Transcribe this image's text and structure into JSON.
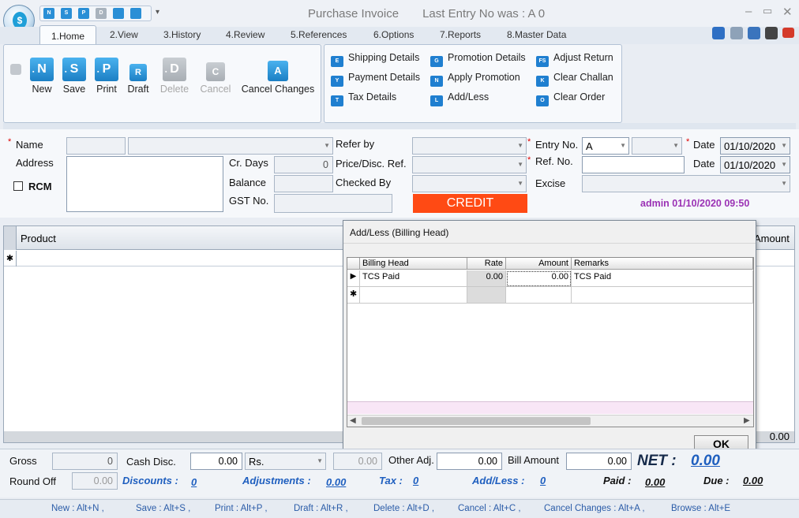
{
  "window": {
    "title": "Purchase Invoice",
    "last_entry": "Last Entry No was : A 0",
    "logo": "$"
  },
  "qat": {
    "icons": [
      "new-icon",
      "save-icon",
      "print-icon",
      "draft-icon",
      "doc-icon",
      "doc2-icon"
    ],
    "labels": [
      "N",
      "S",
      "P",
      "D",
      "",
      ""
    ],
    "more": "▾"
  },
  "tabs": [
    "1.Home",
    "2.View",
    "3.History",
    "4.Review",
    "5.References",
    "6.Options",
    "7.Reports",
    "8.Master Data"
  ],
  "ribbon": {
    "buttons": [
      {
        "label": "New",
        "key": "N"
      },
      {
        "label": "Save",
        "key": "S"
      },
      {
        "label": "Print",
        "key": "P"
      },
      {
        "label": "Draft",
        "key": "R"
      },
      {
        "label": "Delete",
        "key": "D"
      },
      {
        "label": "Cancel",
        "key": "C"
      },
      {
        "label": "Cancel Changes",
        "key": "A"
      }
    ],
    "links": [
      {
        "label": "Shipping Details",
        "key": "E"
      },
      {
        "label": "Payment Details",
        "key": "Y"
      },
      {
        "label": "Tax Details",
        "key": "T"
      },
      {
        "label": "Promotion Details",
        "key": "G"
      },
      {
        "label": "Apply Promotion",
        "key": "N"
      },
      {
        "label": "Add/Less",
        "key": "L"
      },
      {
        "label": "Adjust Return",
        "key": "FS"
      },
      {
        "label": "Clear Challan",
        "key": "K"
      },
      {
        "label": "Clear Order",
        "key": "O"
      }
    ]
  },
  "form": {
    "name_label": "Name",
    "address_label": "Address",
    "rcm_label": "RCM",
    "cr_days_label": "Cr. Days",
    "cr_days_value": "0",
    "balance_label": "Balance",
    "gst_label": "GST No.",
    "refer_by_label": "Refer by",
    "price_ref_label": "Price/Disc. Ref.",
    "checked_by_label": "Checked By",
    "credit": "CREDIT",
    "entry_no_label": "Entry No.",
    "entry_no_value": "A",
    "ref_no_label": "Ref. No.",
    "excise_label": "Excise",
    "date_label": "Date",
    "date1": "01/10/2020",
    "date2_label": "Date",
    "date2": "01/10/2020",
    "admin": "admin 01/10/2020 09:50",
    "required_marker": "*"
  },
  "grid": {
    "product_header": "Product",
    "amount_header": "Amount",
    "new_row_marker": "✱",
    "total": "0.00"
  },
  "dialog": {
    "title": "Add/Less (Billing Head)",
    "columns": [
      "Billing Head",
      "Rate",
      "Amount",
      "Remarks"
    ],
    "rows": [
      {
        "head": "TCS Paid",
        "rate": "0.00",
        "amount": "0.00",
        "remarks": "TCS Paid"
      }
    ],
    "row_marker": "▶",
    "new_row_marker": "✱",
    "ok": "OK"
  },
  "footer": {
    "gross_label": "Gross",
    "gross_value": "0",
    "cash_disc_label": "Cash Disc.",
    "cash_disc_value": "0.00",
    "cash_disc_unit": "Rs.",
    "cash_disc_amount": "0.00",
    "other_adj_label": "Other Adj.",
    "other_adj_value": "0.00",
    "bill_amount_label": "Bill Amount",
    "bill_amount_value": "0.00",
    "net_label": "NET :",
    "net_value": "0.00",
    "round_off_label": "Round Off",
    "round_off_value": "0.00",
    "discounts_label": "Discounts :",
    "discounts_value": "0",
    "adjustments_label": "Adjustments :",
    "adjustments_value": "0.00",
    "tax_label": "Tax :",
    "tax_value": "0",
    "addless_label": "Add/Less :",
    "addless_value": "0",
    "paid_label": "Paid :",
    "paid_value": "0.00",
    "due_label": "Due :",
    "due_value": "0.00"
  },
  "shortcuts": [
    "New : Alt+N ,",
    "Save : Alt+S ,",
    "Print : Alt+P ,",
    "Draft : Alt+R ,",
    "Delete : Alt+D ,",
    "Cancel : Alt+C ,",
    "Cancel Changes : Alt+A ,",
    "Browse : Alt+E"
  ],
  "colors": {
    "credit": "#ff4a14",
    "admin": "#9b32b5",
    "accent": "#1f7fd0",
    "link": "#1f5fbf"
  }
}
